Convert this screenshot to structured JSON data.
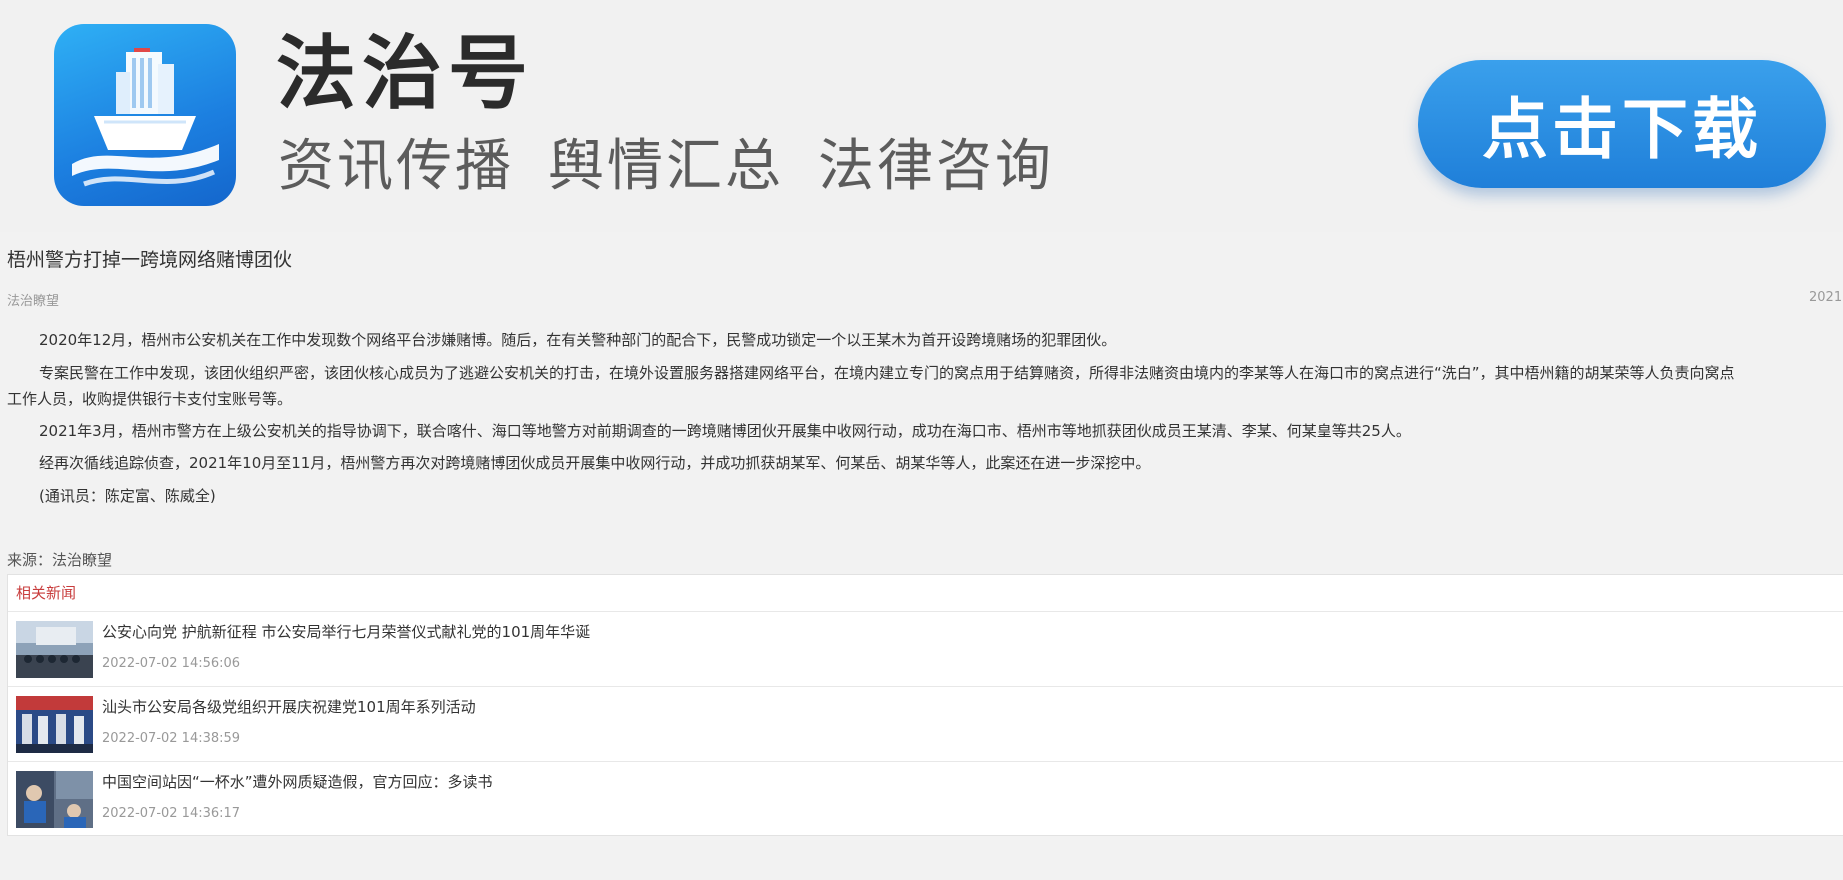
{
  "banner": {
    "brand_name": "法治号",
    "slogans": [
      "资讯传播",
      "舆情汇总",
      "法律咨询"
    ],
    "download_label": "点击下载",
    "accent_color": "#1f7fd9"
  },
  "article": {
    "title": "梧州警方打掉一跨境网络赌博团伙",
    "source_tag": "法治瞭望",
    "date_partial": "2021",
    "paragraphs": [
      "2020年12月，梧州市公安机关在工作中发现数个网络平台涉嫌赌博。随后，在有关警种部门的配合下，民警成功锁定一个以王某木为首开设跨境赌场的犯罪团伙。",
      "专案民警在工作中发现，该团伙组织严密，该团伙核心成员为了逃避公安机关的打击，在境外设置服务器搭建网络平台，在境内建立专门的窝点用于结算赌资，所得非法赌资由境内的李某等人在海口市的窝点进行“洗白”，其中梧州籍的胡某荣等人负责向窝点",
      "工作人员，收购提供银行卡支付宝账号等。",
      "2021年3月，梧州市警方在上级公安机关的指导协调下，联合喀什、海口等地警方对前期调查的一跨境赌博团伙开展集中收网行动，成功在海口市、梧州市等地抓获团伙成员王某清、李某、何某皇等共25人。",
      "经再次循线追踪侦查，2021年10月至11月，梧州警方再次对跨境赌博团伙成员开展集中收网行动，并成功抓获胡某军、何某岳、胡某华等人，此案还在进一步深挖中。",
      "(通讯员：陈定富、陈威全)"
    ],
    "source_line": "来源：法治瞭望"
  },
  "related": {
    "header": "相关新闻",
    "header_color": "#c83c3c",
    "items": [
      {
        "title": "公安心向党 护航新征程 市公安局举行七月荣誉仪式献礼党的101周年华诞",
        "time": "2022-07-02 14:56:06"
      },
      {
        "title": "汕头市公安局各级党组织开展庆祝建党101周年系列活动",
        "time": "2022-07-02 14:38:59"
      },
      {
        "title": "中国空间站因“一杯水”遭外网质疑造假，官方回应：多读书",
        "time": "2022-07-02 14:36:17"
      }
    ]
  }
}
